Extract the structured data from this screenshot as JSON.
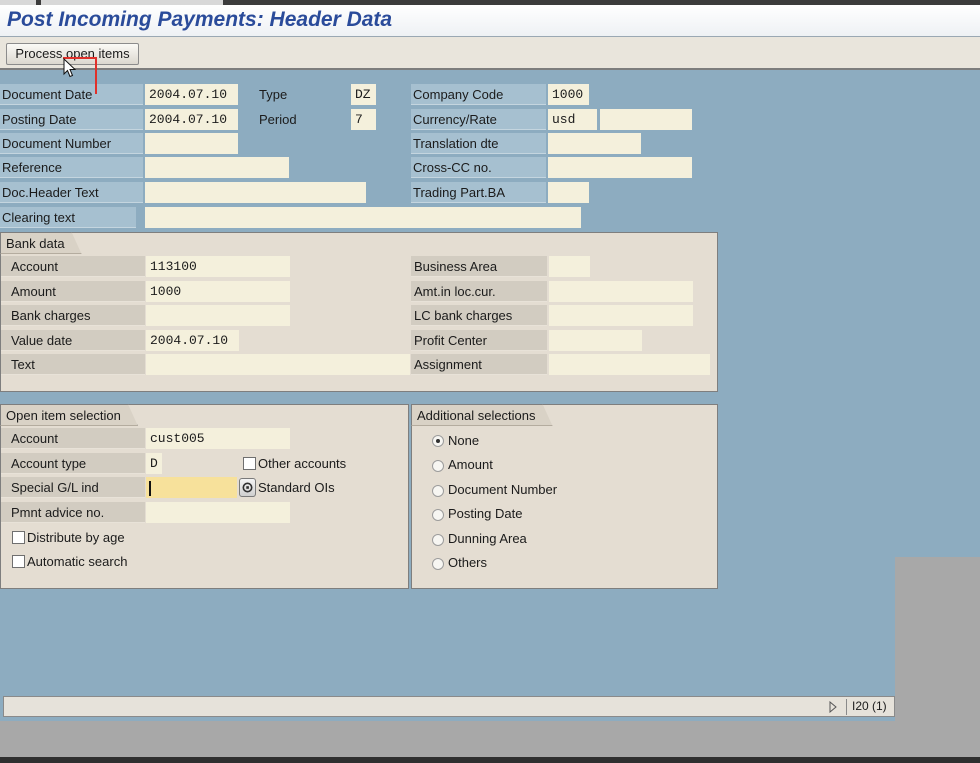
{
  "window": {
    "title": "Post Incoming Payments: Header Data"
  },
  "toolbar": {
    "process_open_items": "Process open items"
  },
  "header": {
    "document_date": {
      "label": "Document Date",
      "value": "2004.07.10"
    },
    "type": {
      "label": "Type",
      "value": "DZ"
    },
    "company_code": {
      "label": "Company Code",
      "value": "1000"
    },
    "posting_date": {
      "label": "Posting Date",
      "value": "2004.07.10"
    },
    "period": {
      "label": "Period",
      "value": "7"
    },
    "currency_rate": {
      "label": "Currency/Rate",
      "value": "usd",
      "rate": ""
    },
    "document_number": {
      "label": "Document Number",
      "value": ""
    },
    "translation_dte": {
      "label": "Translation dte",
      "value": ""
    },
    "reference": {
      "label": "Reference",
      "value": ""
    },
    "cross_cc_no": {
      "label": "Cross-CC no.",
      "value": ""
    },
    "doc_header_text": {
      "label": "Doc.Header Text",
      "value": ""
    },
    "trading_part_ba": {
      "label": "Trading Part.BA",
      "value": ""
    },
    "clearing_text": {
      "label": "Clearing text",
      "value": ""
    }
  },
  "bank_data": {
    "title": "Bank data",
    "account": {
      "label": "Account",
      "value": "113100"
    },
    "amount": {
      "label": "Amount",
      "value": "1000"
    },
    "bank_charges": {
      "label": "Bank charges",
      "value": ""
    },
    "value_date": {
      "label": "Value date",
      "value": "2004.07.10"
    },
    "text": {
      "label": "Text",
      "value": ""
    },
    "business_area": {
      "label": "Business Area",
      "value": ""
    },
    "amt_loc_cur": {
      "label": "Amt.in loc.cur.",
      "value": ""
    },
    "lc_bank_charges": {
      "label": "LC bank charges",
      "value": ""
    },
    "profit_center": {
      "label": "Profit Center",
      "value": ""
    },
    "assignment": {
      "label": "Assignment",
      "value": ""
    }
  },
  "open_item_selection": {
    "title": "Open item selection",
    "account": {
      "label": "Account",
      "value": "cust005"
    },
    "account_type": {
      "label": "Account type",
      "value": "D"
    },
    "other_accounts": {
      "label": "Other accounts",
      "checked": false
    },
    "special_gl_ind": {
      "label": "Special G/L ind",
      "value": ""
    },
    "standard_ois": {
      "label": "Standard OIs",
      "checked": true
    },
    "pmnt_advice_no": {
      "label": "Pmnt advice no.",
      "value": ""
    },
    "distribute_by_age": {
      "label": "Distribute by age",
      "checked": false
    },
    "automatic_search": {
      "label": "Automatic search",
      "checked": false
    }
  },
  "additional_selections": {
    "title": "Additional selections",
    "options": [
      "None",
      "Amount",
      "Document Number",
      "Posting Date",
      "Dunning Area",
      "Others"
    ],
    "selected": "None"
  },
  "status_bar": {
    "system": "I20 (1)"
  },
  "colors": {
    "title": "#2a4b9a",
    "background": "#8dacc0",
    "group": "#e4ddd2",
    "field": "#f4f0dc",
    "active_field": "#f7e19b"
  }
}
